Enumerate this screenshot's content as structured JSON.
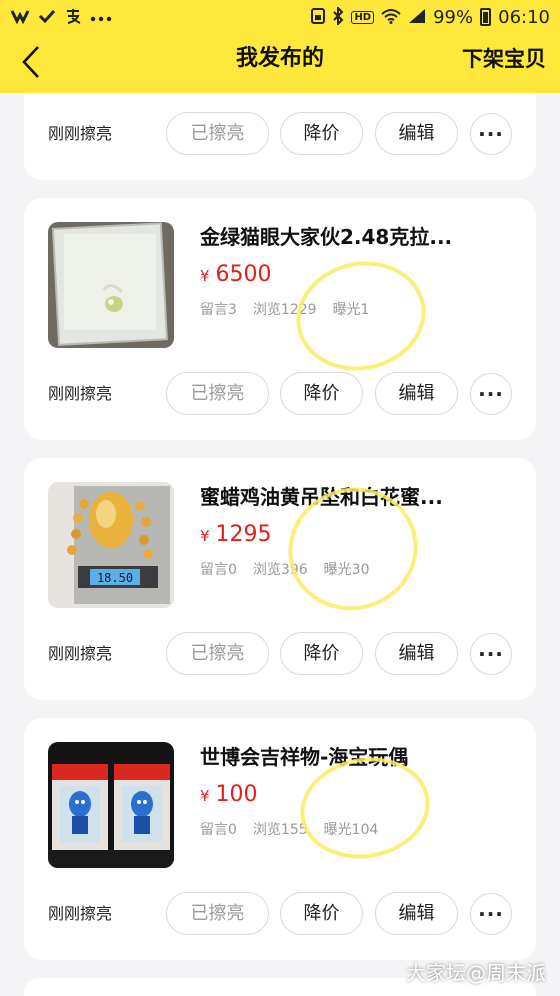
{
  "status_bar": {
    "time": "06:10",
    "battery": "99%",
    "left_icons": [
      "weibo-icon",
      "check-icon",
      "alipay-icon",
      "more-dots-icon"
    ]
  },
  "header": {
    "back_icon": "chevron-left-icon",
    "title": "我发布的",
    "right_action": "下架宝贝"
  },
  "actions": {
    "just_polished": "刚刚擦亮",
    "polished": "已擦亮",
    "reduce_price": "降价",
    "edit": "编辑",
    "more": "···"
  },
  "items": [
    {
      "title": "金绿猫眼大家伙2.48克拉...",
      "currency": "¥",
      "price": "6500",
      "stats": [
        "留言3",
        "浏览1229",
        "曝光1"
      ]
    },
    {
      "title": "蜜蜡鸡油黄吊坠和白花蜜...",
      "currency": "¥",
      "price": "1295",
      "stats": [
        "留言0",
        "浏览396",
        "曝光30"
      ],
      "scale_reading": "18.50"
    },
    {
      "title": "世博会吉祥物-海宝玩偶",
      "currency": "¥",
      "price": "100",
      "stats": [
        "留言0",
        "浏览155",
        "曝光104"
      ]
    }
  ],
  "watermark": "大家坛@周末派",
  "colors": {
    "header_bg": "#ffe83c",
    "price": "#e0201a",
    "page_bg": "#f4f4f6"
  }
}
